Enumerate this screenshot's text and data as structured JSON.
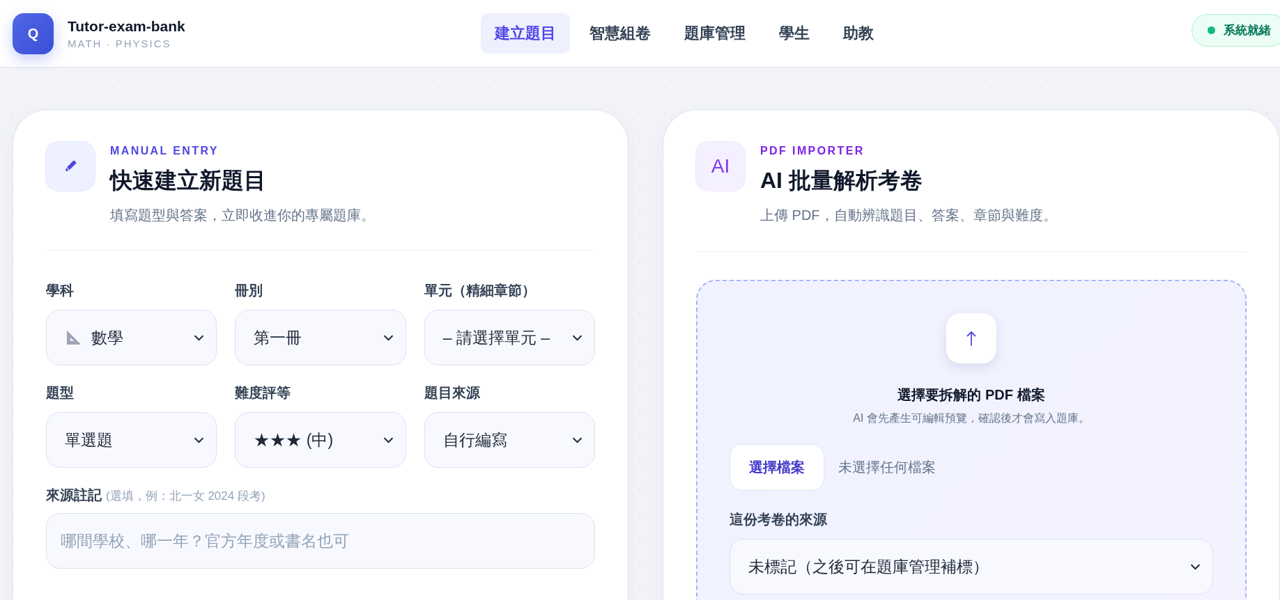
{
  "app": {
    "logo_letter": "Q",
    "name": "Tutor-exam-bank",
    "tagline": "MATH · PHYSICS"
  },
  "nav": [
    {
      "label": "建立題目",
      "selected": true
    },
    {
      "label": "智慧組卷",
      "selected": false
    },
    {
      "label": "題庫管理",
      "selected": false
    },
    {
      "label": "學生",
      "selected": false
    },
    {
      "label": "助教",
      "selected": false
    }
  ],
  "status": {
    "label": "系統就緒"
  },
  "manual": {
    "eyebrow": "MANUAL ENTRY",
    "title": "快速建立新題目",
    "subtitle": "填寫題型與答案，立即收進你的專屬題庫。",
    "fields": [
      {
        "label": "學科",
        "value": "數學",
        "kind": "icon-select"
      },
      {
        "label": "冊別",
        "value": "第一冊",
        "kind": "select"
      },
      {
        "label": "單元（精細章節）",
        "value": "– 請選擇單元 –",
        "kind": "select"
      },
      {
        "label": "題型",
        "value": "單選題",
        "kind": "select"
      },
      {
        "label": "難度評等",
        "value": "★★★ (中)",
        "kind": "select"
      },
      {
        "label": "題目來源",
        "value": "自行編寫",
        "kind": "select"
      }
    ],
    "note": {
      "label": "來源註記",
      "hint": "(選填，例：北一女 2024 段考)",
      "placeholder": "哪間學校、哪一年？官方年度或書名也可"
    }
  },
  "importer": {
    "eyebrow": "PDF IMPORTER",
    "badge": "AI",
    "title": "AI 批量解析考卷",
    "subtitle": "上傳 PDF，自動辨識題目、答案、章節與難度。",
    "dropzone": {
      "title": "選擇要拆解的 PDF 檔案",
      "subtitle": "AI 會先產生可編輯預覽，確認後才會寫入題庫。",
      "button": "選擇檔案",
      "file_status": "未選擇任何檔案",
      "source_label": "這份考卷的來源",
      "source_value": "未標記（之後可在題庫管理補標）"
    }
  }
}
